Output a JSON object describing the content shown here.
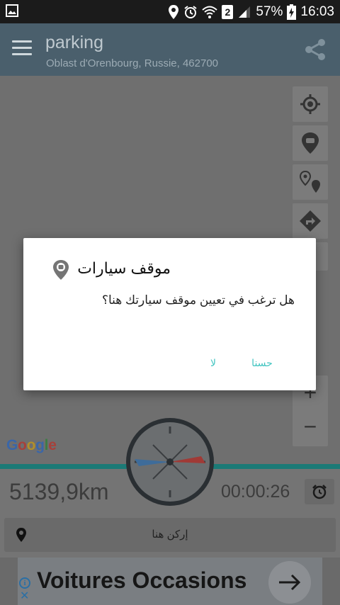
{
  "statusbar": {
    "sim_slot": "2",
    "battery": "57%",
    "time": "16:03",
    "icons": [
      "gallery-icon",
      "location-icon",
      "alarm-icon",
      "wifi-icon",
      "signal-icon",
      "battery-charging-icon"
    ]
  },
  "appbar": {
    "title": "parking",
    "subtitle": "Oblast d'Orenbourg, Russie, 462700",
    "menu_icon": "hamburger-menu-icon",
    "share_icon": "share-icon"
  },
  "map": {
    "attribution": [
      "G",
      "o",
      "o",
      "g",
      "l",
      "e"
    ],
    "buttons": [
      "my-location-icon",
      "car-marker-icon",
      "markers-icon",
      "directions-icon"
    ],
    "zoom_in": "+",
    "zoom_out": "−"
  },
  "dashboard": {
    "distance": "5139,9km",
    "timer": "00:00:26",
    "park_here_label": "إركن هنا"
  },
  "ad": {
    "text": "Voitures Occasions",
    "info": "i",
    "close": "✕"
  },
  "dialog": {
    "title": "موقف سيارات",
    "message": "هل ترغب في تعيين موقف سيارتك هنا؟",
    "ok_label": "حسنا",
    "cancel_label": "لا"
  },
  "colors": {
    "accent": "#40c4c0",
    "appbar": "#4a5f6c",
    "teal_strip": "#1b7a76"
  }
}
